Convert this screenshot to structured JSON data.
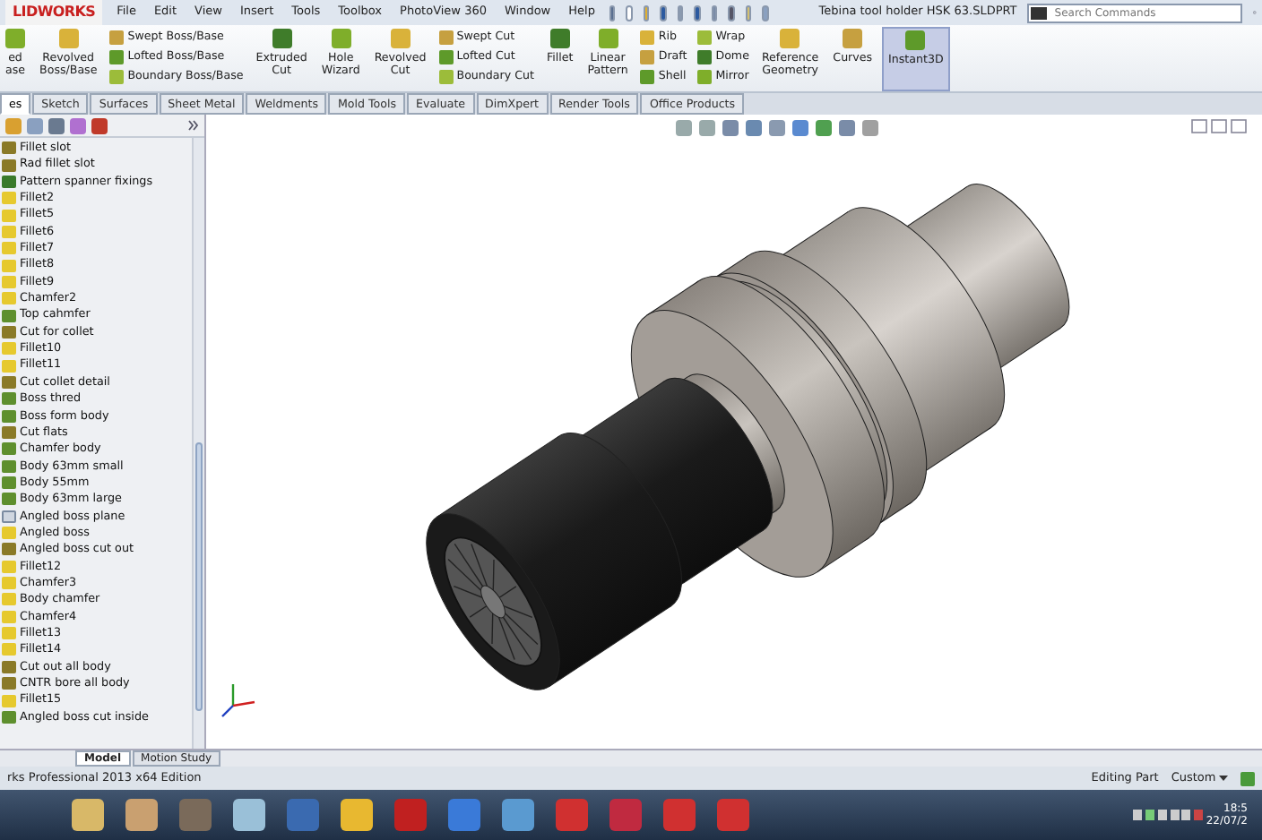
{
  "app_logo": "LIDWORKS",
  "menu": [
    "File",
    "Edit",
    "View",
    "Insert",
    "Tools",
    "Toolbox",
    "PhotoView 360",
    "Window",
    "Help"
  ],
  "window": {
    "title": "Tebina tool holder HSK 63.SLDPRT"
  },
  "search": {
    "placeholder": "Search Commands"
  },
  "ribbon": [
    {
      "kind": "big",
      "lines": [
        "ed",
        "ase"
      ],
      "on": false
    },
    {
      "kind": "big",
      "lines": [
        "Revolved",
        "Boss/Base"
      ],
      "on": false
    },
    {
      "kind": "stack",
      "items": [
        "Swept Boss/Base",
        "Lofted Boss/Base",
        "Boundary Boss/Base"
      ]
    },
    {
      "kind": "big",
      "lines": [
        "Extruded",
        "Cut"
      ],
      "on": false
    },
    {
      "kind": "big",
      "lines": [
        "Hole",
        "Wizard"
      ],
      "on": false
    },
    {
      "kind": "big",
      "lines": [
        "Revolved",
        "Cut"
      ],
      "on": false
    },
    {
      "kind": "stack",
      "items": [
        "Swept Cut",
        "Lofted Cut",
        "Boundary Cut"
      ]
    },
    {
      "kind": "big",
      "lines": [
        "Fillet"
      ],
      "on": false
    },
    {
      "kind": "big",
      "lines": [
        "Linear",
        "Pattern"
      ],
      "on": false
    },
    {
      "kind": "stack",
      "items": [
        "Rib",
        "Draft",
        "Shell"
      ]
    },
    {
      "kind": "stack",
      "items": [
        "Wrap",
        "Dome",
        "Mirror"
      ]
    },
    {
      "kind": "big",
      "lines": [
        "Reference",
        "Geometry"
      ],
      "on": false
    },
    {
      "kind": "big",
      "lines": [
        "Curves"
      ],
      "on": false
    },
    {
      "kind": "big",
      "lines": [
        "Instant3D"
      ],
      "on": true
    }
  ],
  "tabs": [
    {
      "label": "es",
      "selected": true
    },
    {
      "label": "Sketch",
      "selected": false
    },
    {
      "label": "Surfaces",
      "selected": false
    },
    {
      "label": "Sheet Metal",
      "selected": false
    },
    {
      "label": "Weldments",
      "selected": false
    },
    {
      "label": "Mold Tools",
      "selected": false
    },
    {
      "label": "Evaluate",
      "selected": false
    },
    {
      "label": "DimXpert",
      "selected": false
    },
    {
      "label": "Render Tools",
      "selected": false
    },
    {
      "label": "Office Products",
      "selected": false
    }
  ],
  "feature_tree": [
    {
      "label": "Fillet slot",
      "kind": "cut"
    },
    {
      "label": "Rad fillet slot",
      "kind": "cut"
    },
    {
      "label": "Pattern spanner fixings",
      "kind": "pattern"
    },
    {
      "label": "Fillet2",
      "kind": "fillet"
    },
    {
      "label": "Fillet5",
      "kind": "fillet"
    },
    {
      "label": "Fillet6",
      "kind": "fillet"
    },
    {
      "label": "Fillet7",
      "kind": "fillet"
    },
    {
      "label": "Fillet8",
      "kind": "fillet"
    },
    {
      "label": "Fillet9",
      "kind": "fillet"
    },
    {
      "label": "Chamfer2",
      "kind": "fillet"
    },
    {
      "label": "Top cahmfer",
      "kind": "extrude"
    },
    {
      "label": "Cut for collet",
      "kind": "cut"
    },
    {
      "label": "Fillet10",
      "kind": "fillet"
    },
    {
      "label": "Fillet11",
      "kind": "fillet"
    },
    {
      "label": "Cut collet detail",
      "kind": "cut"
    },
    {
      "label": "Boss thred",
      "kind": "extrude"
    },
    {
      "label": "Boss form body",
      "kind": "extrude"
    },
    {
      "label": "Cut flats",
      "kind": "cut"
    },
    {
      "label": "Chamfer body",
      "kind": "extrude"
    },
    {
      "label": "Body 63mm small",
      "kind": "extrude"
    },
    {
      "label": "Body 55mm",
      "kind": "extrude"
    },
    {
      "label": "Body 63mm large",
      "kind": "extrude"
    },
    {
      "label": "Angled boss plane",
      "kind": "plane"
    },
    {
      "label": "Angled boss",
      "kind": "fillet"
    },
    {
      "label": "Angled boss cut out",
      "kind": "cut"
    },
    {
      "label": "Fillet12",
      "kind": "fillet"
    },
    {
      "label": "Chamfer3",
      "kind": "fillet"
    },
    {
      "label": "Body chamfer",
      "kind": "fillet"
    },
    {
      "label": "Chamfer4",
      "kind": "fillet"
    },
    {
      "label": "Fillet13",
      "kind": "fillet"
    },
    {
      "label": "Fillet14",
      "kind": "fillet"
    },
    {
      "label": "Cut out all body",
      "kind": "cut"
    },
    {
      "label": "CNTR bore all body",
      "kind": "cut"
    },
    {
      "label": "Fillet15",
      "kind": "fillet"
    },
    {
      "label": "Angled boss cut inside",
      "kind": "extrude"
    }
  ],
  "bottom_tabs": [
    {
      "label": "Model",
      "selected": true
    },
    {
      "label": "Motion Study",
      "selected": false
    }
  ],
  "status_bar": {
    "edition": "rks Professional 2013 x64 Edition",
    "mode": "Editing Part",
    "units": "Custom"
  },
  "taskbar": {
    "time": "18:5",
    "date": "22/07/2"
  }
}
